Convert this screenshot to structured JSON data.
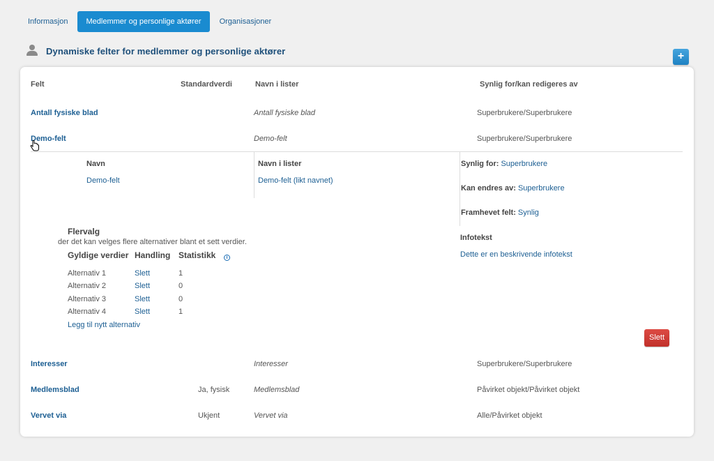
{
  "tabs": [
    {
      "label": "Informasjon"
    },
    {
      "label": "Medlemmer og personlige aktører"
    },
    {
      "label": "Organisasjoner"
    }
  ],
  "section": {
    "title": "Dynamiske felter for medlemmer og personlige aktører",
    "icon": "person-icon",
    "add_label": "+"
  },
  "columns": {
    "felt": "Felt",
    "standardverdi": "Standardverdi",
    "navn_i_lister": "Navn i lister",
    "synlig": "Synlig for/kan redigeres av"
  },
  "rows": [
    {
      "name": "Antall fysiske blad",
      "default": "",
      "list_name": "Antall fysiske blad",
      "visible": "Superbrukere/Superbrukere"
    },
    {
      "name": "Demo-felt",
      "default": "",
      "list_name": "Demo-felt",
      "visible": "Superbrukere/Superbrukere"
    },
    {
      "name": "Interesser",
      "default": "",
      "list_name": "Interesser",
      "visible": "Superbrukere/Superbrukere"
    },
    {
      "name": "Medlemsblad",
      "default": "Ja, fysisk",
      "list_name": "Medlemsblad",
      "visible": "Påvirket objekt/Påvirket objekt"
    },
    {
      "name": "Vervet via",
      "default": "Ukjent",
      "list_name": "Vervet via",
      "visible": "Alle/Påvirket objekt"
    }
  ],
  "detail": {
    "navn_label": "Navn",
    "navn_value": "Demo-felt",
    "navn_i_lister_label": "Navn i lister",
    "navn_i_lister_value": "Demo-felt (likt navnet)",
    "synlig_for_label": "Synlig for:",
    "synlig_for_value": "Superbrukere",
    "kan_endres_label": "Kan endres av:",
    "kan_endres_value": "Superbrukere",
    "framhevet_label": "Framhevet felt:",
    "framhevet_value": "Synlig",
    "flervalg_title": "Flervalg",
    "flervalg_desc": "der det kan velges flere alternativer blant et sett verdier.",
    "col_gyldige": "Gyldige verdier",
    "col_handling": "Handling",
    "col_statistikk": "Statistikk",
    "alternatives": [
      {
        "name": "Alternativ 1",
        "action": "Slett",
        "stat": "1"
      },
      {
        "name": "Alternativ 2",
        "action": "Slett",
        "stat": "0"
      },
      {
        "name": "Alternativ 3",
        "action": "Slett",
        "stat": "0"
      },
      {
        "name": "Alternativ 4",
        "action": "Slett",
        "stat": "1"
      }
    ],
    "add_alternative": "Legg til nytt alternativ",
    "infotekst_label": "Infotekst",
    "infotekst_value": "Dette er en beskrivende infotekst",
    "delete_label": "Slett"
  },
  "colors": {
    "accent": "#1a8bd0",
    "link": "#1d5f93",
    "danger": "#c9372f"
  }
}
